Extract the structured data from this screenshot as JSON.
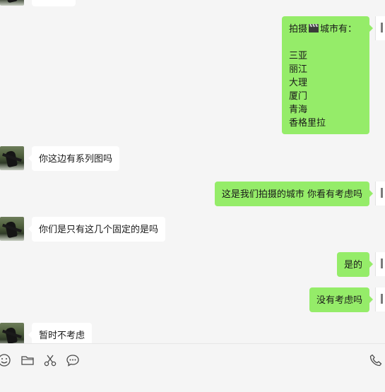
{
  "messages": {
    "top_partial": "",
    "city_list": {
      "intro_prefix": "拍摄",
      "intro_suffix": "城市有：",
      "cities": [
        "三亚",
        "丽江",
        "大理",
        "厦门",
        "青海",
        "香格里拉"
      ]
    },
    "m1": "你这边有系列图吗",
    "m2": "这是我们拍摄的城市 你看有考虑吗",
    "m3": "你们是只有这几个固定的是吗",
    "m4": "是的",
    "m5": "没有考虑吗",
    "m6": "暂时不考虑"
  },
  "toolbar": {
    "icons": [
      "emoji-icon",
      "folder-icon",
      "scissors-icon",
      "chat-history-icon",
      "phone-icon"
    ]
  },
  "colors": {
    "outgoing_bubble": "#95ec69",
    "incoming_bubble": "#ffffff",
    "background": "#f5f5f5"
  }
}
